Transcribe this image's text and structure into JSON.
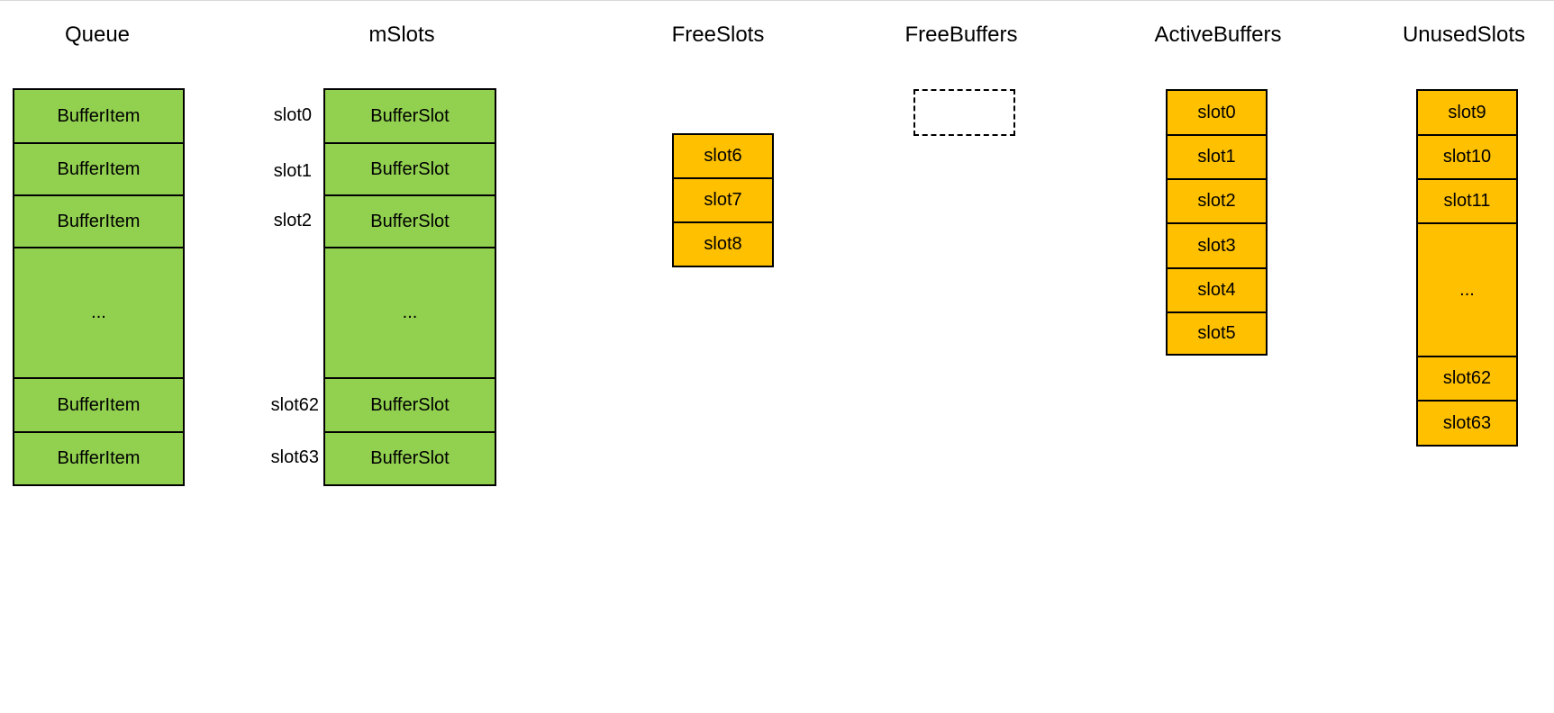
{
  "colors": {
    "green_fill": "#92d050",
    "orange_fill": "#ffc000",
    "outline": "#000000"
  },
  "queue": {
    "title": "Queue",
    "cells": [
      "BufferItem",
      "BufferItem",
      "BufferItem",
      "...",
      "BufferItem",
      "BufferItem"
    ]
  },
  "mslots": {
    "title": "mSlots",
    "row_labels": [
      "slot0",
      "slot1",
      "slot2",
      "slot62",
      "slot63"
    ],
    "cells": [
      "BufferSlot",
      "BufferSlot",
      "BufferSlot",
      "...",
      "BufferSlot",
      "BufferSlot"
    ]
  },
  "free_slots": {
    "title": "FreeSlots",
    "cells": [
      "slot6",
      "slot7",
      "slot8"
    ]
  },
  "free_buffers": {
    "title": "FreeBuffers"
  },
  "active_buffers": {
    "title": "ActiveBuffers",
    "cells": [
      "slot0",
      "slot1",
      "slot2",
      "slot3",
      "slot4",
      "slot5"
    ]
  },
  "unused_slots": {
    "title": "UnusedSlots",
    "cells": [
      "slot9",
      "slot10",
      "slot11",
      "...",
      "slot62",
      "slot63"
    ]
  }
}
